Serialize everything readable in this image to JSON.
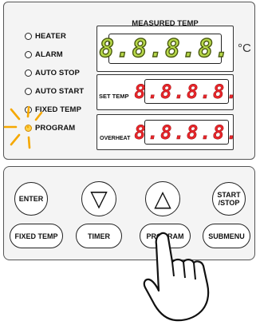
{
  "indicators": [
    {
      "label": "HEATER",
      "on": false
    },
    {
      "label": "ALARM",
      "on": false
    },
    {
      "label": "AUTO STOP",
      "on": false
    },
    {
      "label": "AUTO START",
      "on": false
    },
    {
      "label": "FIXED TEMP",
      "on": false
    },
    {
      "label": "PROGRAM",
      "on": true
    }
  ],
  "measured": {
    "title": "MEASURED TEMP",
    "value": "8.8.8.8.",
    "unit": "°C"
  },
  "set_temp": {
    "label": "SET TEMP",
    "value": "8.8.8.8."
  },
  "overheat": {
    "label": "OVERHEAT",
    "value": "8.8.8.8."
  },
  "buttons": {
    "enter": "ENTER",
    "down": "▽",
    "up": "△",
    "start_stop": "START /STOP",
    "fixed_temp": "FIXED TEMP",
    "timer": "TIMER",
    "program": "PROGRAM",
    "submenu": "SUBMENU"
  },
  "colors": {
    "led_glow": "#f5a800",
    "green_digits": "#b8d94a",
    "red_digits": "#e8252a"
  }
}
